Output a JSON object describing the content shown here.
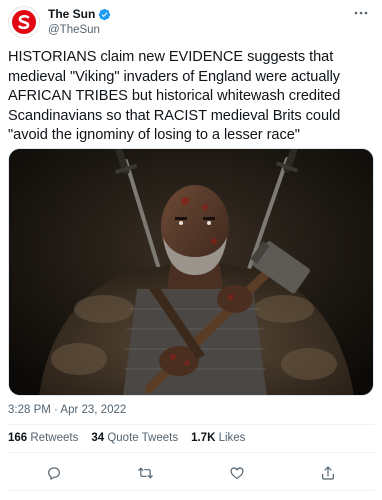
{
  "account": {
    "display_name": "The Sun",
    "handle": "@TheSun",
    "verified": true,
    "avatar_icon": "the-sun-logo",
    "brand_color": "#e30613"
  },
  "tweet": {
    "text": "HISTORIANS claim new EVIDENCE suggests that medieval \"Viking\" invaders of England were actually AFRICAN TRIBES but historical whitewash credited Scandinavians so that RACIST medieval Brits could \"avoid the ignominy of losing to a lesser race\"",
    "timestamp": "3:28 PM · Apr 23, 2022"
  },
  "stats": {
    "retweets_count": "166",
    "retweets_label": "Retweets",
    "quote_count": "34",
    "quote_label": "Quote Tweets",
    "likes_count": "1.7K",
    "likes_label": "Likes"
  },
  "actions": [
    {
      "icon": "reply-icon"
    },
    {
      "icon": "retweet-icon"
    },
    {
      "icon": "like-icon"
    },
    {
      "icon": "share-icon"
    }
  ],
  "colors": {
    "text": "#0f1419",
    "secondary": "#536471",
    "verified": "#1d9bf0",
    "divider": "#eff3f4"
  }
}
